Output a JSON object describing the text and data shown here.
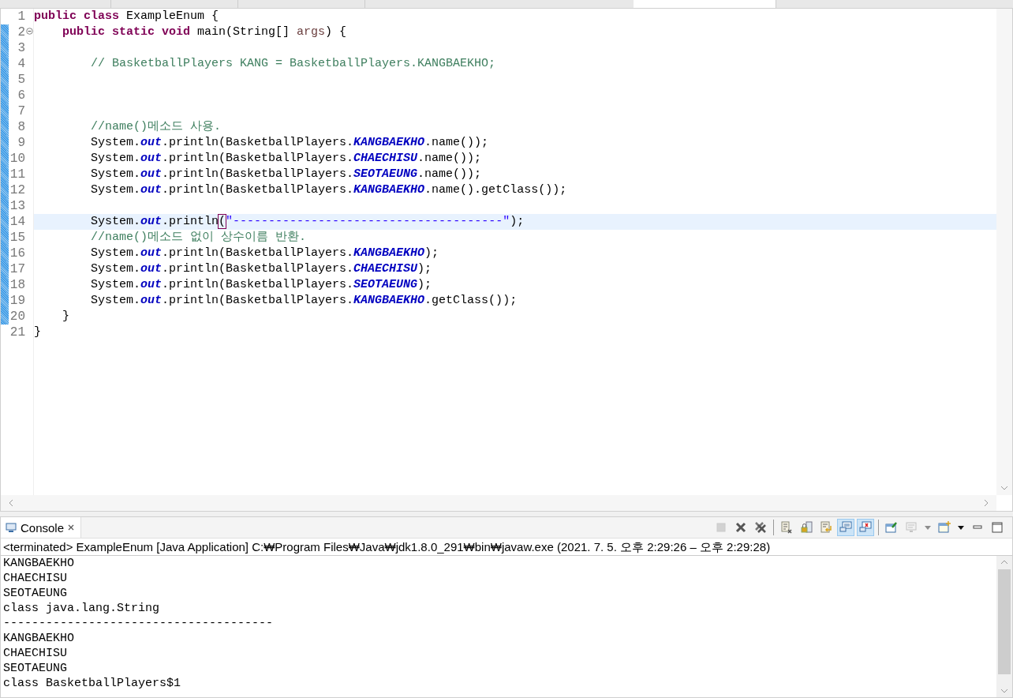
{
  "editor": {
    "lines": [
      {
        "number": "1",
        "current": false,
        "changed": false,
        "tokens": [
          {
            "kind": "keyword",
            "text": "public class"
          },
          {
            "kind": "plain",
            "text": " ExampleEnum {"
          }
        ]
      },
      {
        "number": "2",
        "fold": true,
        "current": false,
        "changed": true,
        "tokens": [
          {
            "kind": "keyword",
            "text": "    public static void"
          },
          {
            "kind": "plain",
            "text": " main(String[] "
          },
          {
            "kind": "param",
            "text": "args"
          },
          {
            "kind": "plain",
            "text": ") {"
          }
        ]
      },
      {
        "number": "3",
        "current": false,
        "changed": true
      },
      {
        "number": "4",
        "current": false,
        "changed": true,
        "tokens": [
          {
            "kind": "comment",
            "text": "        // BasketballPlayers KANG = BasketballPlayers.KANGBAEKHO;"
          }
        ]
      },
      {
        "number": "5",
        "current": false,
        "changed": true
      },
      {
        "number": "6",
        "current": false,
        "changed": true
      },
      {
        "number": "7",
        "current": false,
        "changed": true
      },
      {
        "number": "8",
        "current": false,
        "changed": true,
        "tokens": [
          {
            "kind": "comment",
            "text": "        //name()메소드 사용."
          }
        ]
      },
      {
        "number": "9",
        "current": false,
        "changed": true,
        "tokens": [
          {
            "kind": "plain",
            "text": "        System."
          },
          {
            "kind": "field",
            "text": "out"
          },
          {
            "kind": "plain",
            "text": ".println(BasketballPlayers."
          },
          {
            "kind": "field",
            "text": "KANGBAEKHO"
          },
          {
            "kind": "plain",
            "text": ".name());"
          }
        ]
      },
      {
        "number": "10",
        "current": false,
        "changed": true,
        "tokens": [
          {
            "kind": "plain",
            "text": "        System."
          },
          {
            "kind": "field",
            "text": "out"
          },
          {
            "kind": "plain",
            "text": ".println(BasketballPlayers."
          },
          {
            "kind": "field",
            "text": "CHAECHISU"
          },
          {
            "kind": "plain",
            "text": ".name());"
          }
        ]
      },
      {
        "number": "11",
        "current": false,
        "changed": true,
        "tokens": [
          {
            "kind": "plain",
            "text": "        System."
          },
          {
            "kind": "field",
            "text": "out"
          },
          {
            "kind": "plain",
            "text": ".println(BasketballPlayers."
          },
          {
            "kind": "field",
            "text": "SEOTAEUNG"
          },
          {
            "kind": "plain",
            "text": ".name());"
          }
        ]
      },
      {
        "number": "12",
        "current": false,
        "changed": true,
        "tokens": [
          {
            "kind": "plain",
            "text": "        System."
          },
          {
            "kind": "field",
            "text": "out"
          },
          {
            "kind": "plain",
            "text": ".println(BasketballPlayers."
          },
          {
            "kind": "field",
            "text": "KANGBAEKHO"
          },
          {
            "kind": "plain",
            "text": ".name().getClass());"
          }
        ]
      },
      {
        "number": "13",
        "current": false,
        "changed": true
      },
      {
        "number": "14",
        "current": true,
        "changed": true,
        "tokens": [
          {
            "kind": "plain",
            "text": "        System."
          },
          {
            "kind": "field",
            "text": "out"
          },
          {
            "kind": "plain",
            "text": ".println"
          },
          {
            "kind": "bracket",
            "text": "("
          },
          {
            "kind": "string",
            "text": "\"--------------------------------------\""
          },
          {
            "kind": "plain",
            "text": ");"
          }
        ]
      },
      {
        "number": "15",
        "current": false,
        "changed": true,
        "tokens": [
          {
            "kind": "comment",
            "text": "        //name()메소드 없이 상수이름 반환."
          }
        ]
      },
      {
        "number": "16",
        "current": false,
        "changed": true,
        "tokens": [
          {
            "kind": "plain",
            "text": "        System."
          },
          {
            "kind": "field",
            "text": "out"
          },
          {
            "kind": "plain",
            "text": ".println(BasketballPlayers."
          },
          {
            "kind": "field",
            "text": "KANGBAEKHO"
          },
          {
            "kind": "plain",
            "text": ");"
          }
        ]
      },
      {
        "number": "17",
        "current": false,
        "changed": true,
        "tokens": [
          {
            "kind": "plain",
            "text": "        System."
          },
          {
            "kind": "field",
            "text": "out"
          },
          {
            "kind": "plain",
            "text": ".println(BasketballPlayers."
          },
          {
            "kind": "field",
            "text": "CHAECHISU"
          },
          {
            "kind": "plain",
            "text": ");"
          }
        ]
      },
      {
        "number": "18",
        "current": false,
        "changed": true,
        "tokens": [
          {
            "kind": "plain",
            "text": "        System."
          },
          {
            "kind": "field",
            "text": "out"
          },
          {
            "kind": "plain",
            "text": ".println(BasketballPlayers."
          },
          {
            "kind": "field",
            "text": "SEOTAEUNG"
          },
          {
            "kind": "plain",
            "text": ");"
          }
        ]
      },
      {
        "number": "19",
        "current": false,
        "changed": true,
        "tokens": [
          {
            "kind": "plain",
            "text": "        System."
          },
          {
            "kind": "field",
            "text": "out"
          },
          {
            "kind": "plain",
            "text": ".println(BasketballPlayers."
          },
          {
            "kind": "field",
            "text": "KANGBAEKHO"
          },
          {
            "kind": "plain",
            "text": ".getClass());"
          }
        ]
      },
      {
        "number": "20",
        "current": false,
        "changed": true,
        "tokens": [
          {
            "kind": "plain",
            "text": "    }"
          }
        ]
      },
      {
        "number": "21",
        "current": false,
        "changed": false,
        "tokens": [
          {
            "kind": "plain",
            "text": "}"
          }
        ]
      }
    ]
  },
  "console": {
    "tab": {
      "label": "Console",
      "selected": true
    },
    "toolbar": [
      {
        "kind": "stop",
        "disabled": true,
        "selected": false
      },
      {
        "kind": "remove",
        "disabled": false,
        "selected": false
      },
      {
        "kind": "remove-all",
        "disabled": false,
        "selected": false
      },
      {
        "kind": "separator"
      },
      {
        "kind": "clear",
        "disabled": false,
        "selected": false
      },
      {
        "kind": "scroll-lock",
        "disabled": false,
        "selected": false
      },
      {
        "kind": "word-wrap",
        "disabled": false,
        "selected": false
      },
      {
        "kind": "show-output",
        "disabled": false,
        "selected": true
      },
      {
        "kind": "show-error",
        "disabled": false,
        "selected": true
      },
      {
        "kind": "separator"
      },
      {
        "kind": "pin",
        "disabled": false,
        "selected": false
      },
      {
        "kind": "display",
        "disabled": true,
        "selected": false
      },
      {
        "kind": "dropdown",
        "disabled": true,
        "selected": false
      },
      {
        "kind": "new-console",
        "disabled": false,
        "selected": false
      },
      {
        "kind": "dropdown",
        "disabled": false,
        "selected": false
      },
      {
        "kind": "minimize",
        "disabled": false,
        "selected": false
      },
      {
        "kind": "maximize",
        "disabled": false,
        "selected": false
      }
    ],
    "description": "<terminated> ExampleEnum [Java Application] C:₩Program Files₩Java₩jdk1.8.0_291₩bin₩javaw.exe  (2021. 7. 5. 오후 2:29:26 – 오후 2:29:28)",
    "output": [
      "KANGBAEKHO",
      "CHAECHISU",
      "SEOTAEUNG",
      "class java.lang.String",
      "--------------------------------------",
      "KANGBAEKHO",
      "CHAECHISU",
      "SEOTAEUNG",
      "class BasketballPlayers$1"
    ]
  }
}
